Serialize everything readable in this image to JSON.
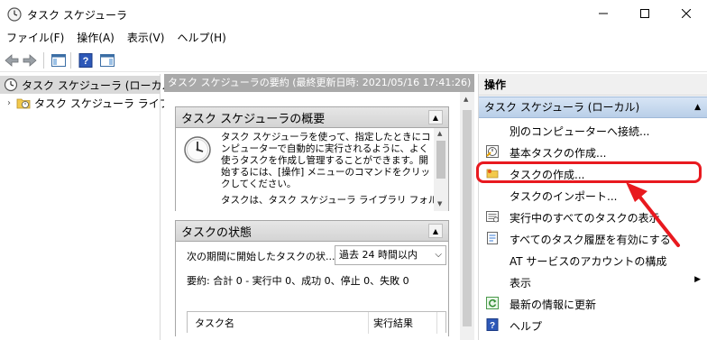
{
  "window": {
    "title": "タスク スケジューラ"
  },
  "menu": [
    "ファイル(F)",
    "操作(A)",
    "表示(V)",
    "ヘルプ(H)"
  ],
  "tree": {
    "items": [
      {
        "label": "タスク スケジューラ (ローカル)",
        "selected": true,
        "icon": "clock-icon"
      },
      {
        "label": "タスク スケジューラ ライブラリ",
        "selected": false,
        "icon": "folder-clock-icon"
      }
    ]
  },
  "center": {
    "header": "タスク スケジューラの要約 (最終更新日時: 2021/05/16 17:41:26)",
    "overview": {
      "title": "タスク スケジューラの概要",
      "collapse": "▲",
      "text": "タスク スケジューラを使って、指定したときにコンピューターで自動的に実行されるように、よく使うタスクを作成し管理することができます。開始するには、[操作] メニューのコマンドをクリックしてください。",
      "text2": "タスクは、タスク スケジューラ ライブラリ フォルダ"
    },
    "status": {
      "title": "タスクの状態",
      "collapse": "▲",
      "period_label": "次の期間に開始したタスクの状...",
      "period_value": "過去 24 時間以内",
      "summary": "要約: 合計 0 - 実行中 0、成功 0、停止 0、失敗 0",
      "table_headers": [
        "タスク名",
        "実行結果"
      ]
    }
  },
  "actions": {
    "header": "操作",
    "group": "タスク スケジューラ (ローカル)",
    "items": [
      {
        "label": "別のコンピューターへ接続...",
        "icon": ""
      },
      {
        "label": "基本タスクの作成...",
        "icon": "basic-task-icon"
      },
      {
        "label": "タスクの作成...",
        "icon": "create-task-icon"
      },
      {
        "label": "タスクのインポート...",
        "icon": ""
      },
      {
        "label": "実行中のすべてのタスクの表示",
        "icon": "running-tasks-icon"
      },
      {
        "label": "すべてのタスク履歴を有効にする",
        "icon": "history-icon"
      },
      {
        "label": "AT サービスのアカウントの構成",
        "icon": ""
      },
      {
        "label": "表示",
        "icon": "",
        "submenu": true
      },
      {
        "label": "最新の情報に更新",
        "icon": "refresh-icon"
      },
      {
        "label": "ヘルプ",
        "icon": "help-icon"
      }
    ]
  },
  "colors": {
    "highlight": "#e8191f",
    "group_bg": "#c6d8ee",
    "center_header": "#a9a9a9"
  }
}
